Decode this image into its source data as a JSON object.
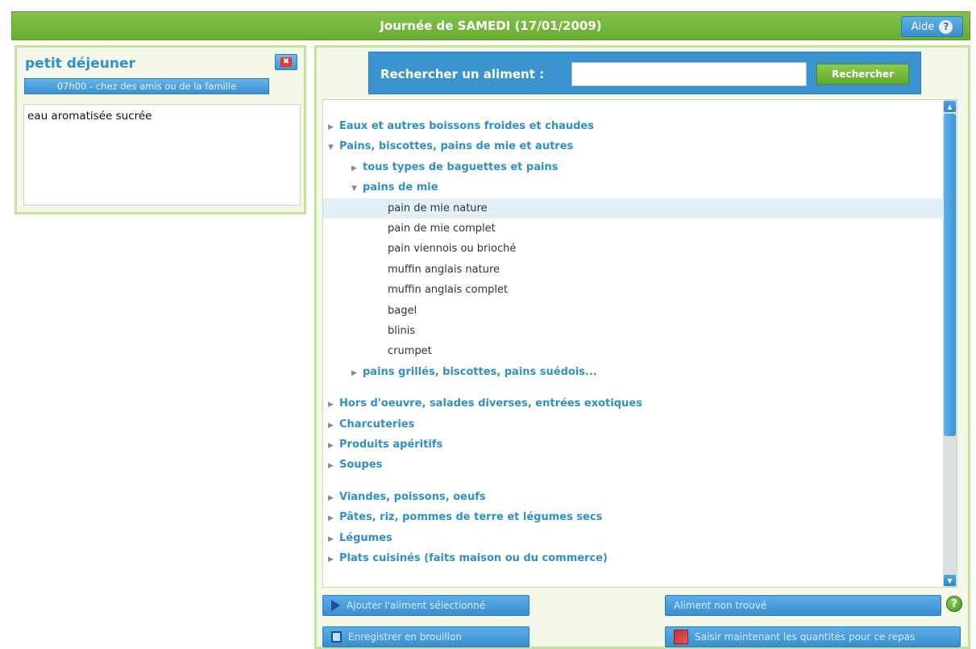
{
  "header": {
    "title": "Journée de SAMEDI (17/01/2009)",
    "aide_label": "Aide",
    "help_icon": "question-mark-icon"
  },
  "meal": {
    "title": "petit déjeuner",
    "time_location": "07h00 - chez des amis ou de la famille",
    "close_icon": "close-x-icon",
    "items": [
      "eau aromatisée sucrée"
    ]
  },
  "search": {
    "label": "Rechercher un aliment :",
    "value": "",
    "placeholder": "",
    "button_label": "Rechercher"
  },
  "food_tree": [
    {
      "label": "Eaux et autres boissons froides et chaudes",
      "type": "cat",
      "level": 0,
      "expanded": false
    },
    {
      "label": "Pains, biscottes, pains de mie et autres",
      "type": "cat",
      "level": 0,
      "expanded": true
    },
    {
      "label": "tous types de baguettes et pains",
      "type": "cat",
      "level": 1,
      "expanded": false
    },
    {
      "label": "pains de mie",
      "type": "cat",
      "level": 1,
      "expanded": true
    },
    {
      "label": "pain de mie nature",
      "type": "leaf",
      "level": 2,
      "selected": true
    },
    {
      "label": "pain de mie complet",
      "type": "leaf",
      "level": 2
    },
    {
      "label": "pain viennois ou brioché",
      "type": "leaf",
      "level": 2
    },
    {
      "label": "muffin anglais nature",
      "type": "leaf",
      "level": 2
    },
    {
      "label": "muffin anglais complet",
      "type": "leaf",
      "level": 2
    },
    {
      "label": "bagel",
      "type": "leaf",
      "level": 2
    },
    {
      "label": "blinis",
      "type": "leaf",
      "level": 2
    },
    {
      "label": "crumpet",
      "type": "leaf",
      "level": 2
    },
    {
      "label": "pains grillés, biscottes, pains suédois...",
      "type": "cat",
      "level": 1,
      "expanded": false
    },
    {
      "label": "Hors d'oeuvre, salades diverses, entrées exotiques",
      "type": "cat",
      "level": 0,
      "expanded": false
    },
    {
      "label": "Charcuteries",
      "type": "cat",
      "level": 0,
      "expanded": false
    },
    {
      "label": "Produits apéritifs",
      "type": "cat",
      "level": 0,
      "expanded": false
    },
    {
      "label": "Soupes",
      "type": "cat",
      "level": 0,
      "expanded": false
    },
    {
      "label": "Viandes, poissons, oeufs",
      "type": "cat",
      "level": 0,
      "expanded": false
    },
    {
      "label": "Pâtes, riz, pommes de terre et légumes secs",
      "type": "cat",
      "level": 0,
      "expanded": false
    },
    {
      "label": "Légumes",
      "type": "cat",
      "level": 0,
      "expanded": false
    },
    {
      "label": "Plats cuisinés (faits maison ou du commerce)",
      "type": "cat",
      "level": 0,
      "expanded": false
    }
  ],
  "actions": {
    "add_selected": "Ajouter l'aliment sélectionné",
    "not_found": "Aliment non trouvé",
    "save_draft": "Enregistrer en brouillon",
    "enter_quantities": "Saisir maintenant les quantités pour ce repas"
  },
  "colors": {
    "header_green": "#6aad32",
    "accent_blue": "#3b94d0",
    "category_text": "#2f8fc9"
  }
}
